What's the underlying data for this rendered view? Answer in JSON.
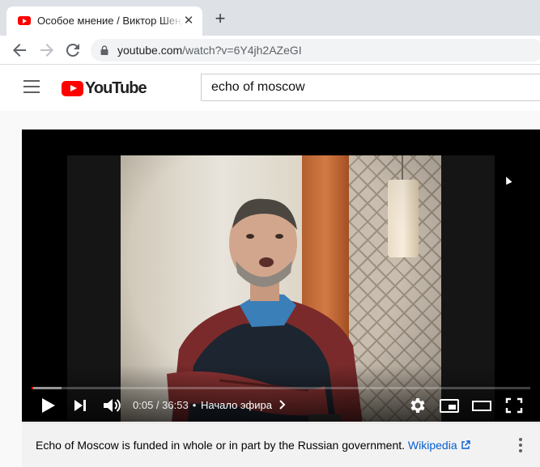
{
  "browser": {
    "tab": {
      "title": "Особое мнение / Виктор Шендерович",
      "favicon": "youtube-favicon-icon",
      "close_icon": "close-icon"
    },
    "new_tab_icon": "plus-icon",
    "nav": {
      "back_icon": "back-arrow-icon",
      "forward_icon": "forward-arrow-icon",
      "reload_icon": "reload-icon"
    },
    "address": {
      "host": "youtube.com",
      "path": "/watch?v=6Y4jh2AZeGI",
      "lock_icon": "lock-icon"
    }
  },
  "youtube": {
    "menu_icon": "hamburger-menu-icon",
    "logo_text": "YouTube",
    "search": {
      "value": "echo of moscow"
    },
    "brand_color": "#ff0000"
  },
  "player": {
    "current_time": "0:05",
    "duration": "36:53",
    "chapter_label": "Начало эфира",
    "played_fraction": 0.002,
    "loaded_fraction": 0.06,
    "icons": [
      "play-icon",
      "next-icon",
      "volume-icon",
      "chapter-chevron-icon",
      "settings-gear-icon",
      "miniplayer-icon",
      "theater-mode-icon",
      "fullscreen-icon"
    ]
  },
  "info_panel": {
    "text": "Echo of Moscow is funded in whole or in part by the Russian government.",
    "link_label": "Wikipedia",
    "link_icon": "external-link-icon",
    "menu_icon": "more-vert-icon"
  }
}
